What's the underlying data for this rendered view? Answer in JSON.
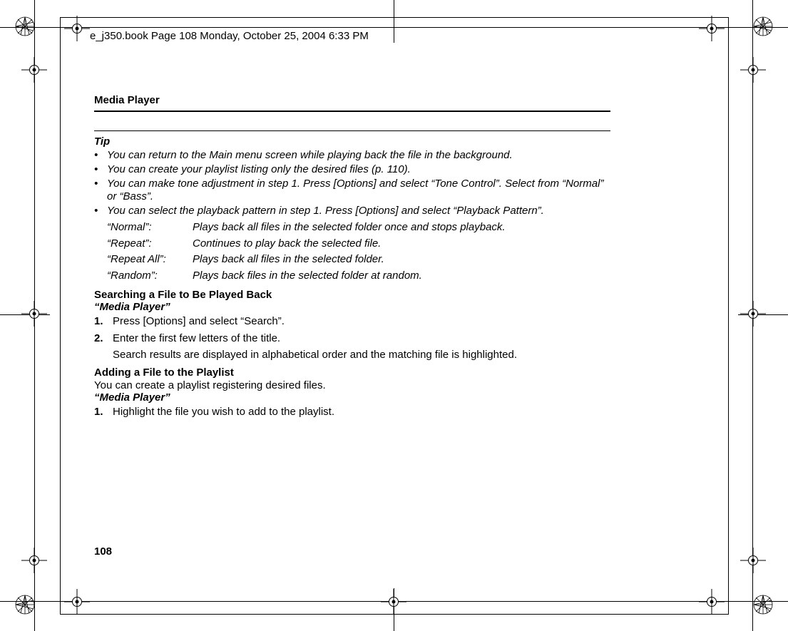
{
  "header": {
    "filename_line": "e_j350.book  Page 108  Monday, October 25, 2004  6:33 PM"
  },
  "running_head": "Media Player",
  "tip_label": "Tip",
  "tips": [
    "You can return to the Main menu screen while playing back the file in the background.",
    "You can create your playlist listing only the desired files (p. 110).",
    "You can make tone adjustment in step 1. Press [Options] and select “Tone Control”. Select from “Normal” or “Bass”.",
    "You can select the playback pattern in step 1. Press [Options] and select “Playback Pattern”."
  ],
  "patterns": [
    {
      "label": "“Normal”:",
      "desc": "Plays back all files in the selected folder once and stops playback."
    },
    {
      "label": "“Repeat”:",
      "desc": "Continues to play back the selected file."
    },
    {
      "label": "“Repeat All”:",
      "desc": "Plays back all files in the selected folder."
    },
    {
      "label": "“Random”:",
      "desc": "Plays back files in the selected folder at random."
    }
  ],
  "section1": {
    "heading": "Searching a File to Be Played Back",
    "path": "“Media Player”",
    "steps": [
      "Press [Options] and select “Search”.",
      "Enter the first few letters of the title."
    ],
    "note_after_step2": "Search results are displayed in alphabetical order and the matching file is highlighted."
  },
  "section2": {
    "heading": "Adding a File to the Playlist",
    "intro": "You can create a playlist registering desired files.",
    "path": "“Media Player”",
    "steps": [
      "Highlight the file you wish to add to the playlist."
    ]
  },
  "page_number": "108"
}
